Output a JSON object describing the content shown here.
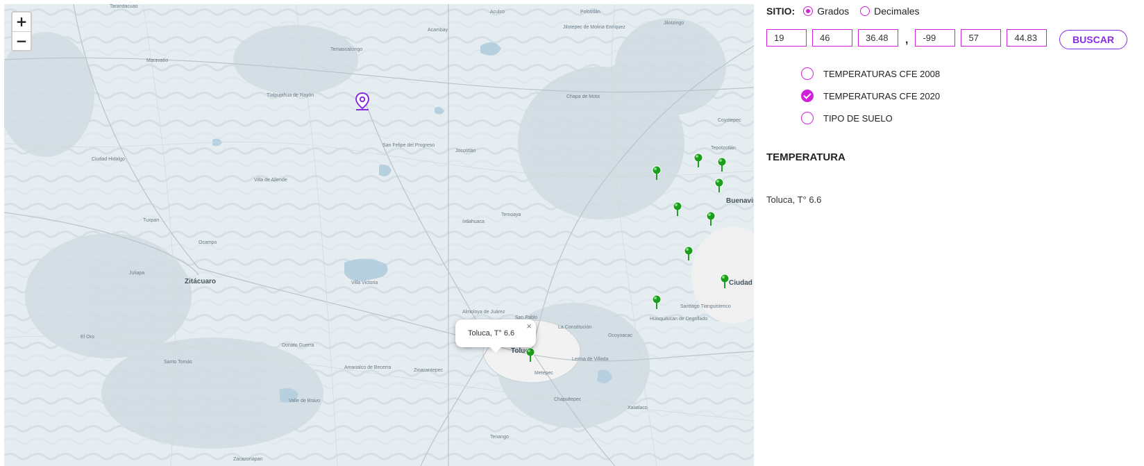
{
  "map": {
    "zoom_in": "+",
    "zoom_out": "−",
    "popup": {
      "text": "Toluca, T° 6.6",
      "close": "×"
    },
    "labels": [
      "Tarandacuao",
      "Maravatío",
      "Temascalcingo",
      "Tlalpujahua de Rayón",
      "Acambay",
      "Jilotepec de Molina Enríquez",
      "Chapa de Mota",
      "Ciudad Hidalgo",
      "Zitácuaro",
      "Villa Victoria",
      "Almoloya de Juárez",
      "Toluca",
      "Metepec",
      "Lerma de Villada",
      "Ocoyoacac",
      "Tenango",
      "Valle de Bravo",
      "Amanalco de Becerra",
      "Buenavista",
      "Ciudad",
      "Juliapa",
      "Tuxpan",
      "San Felipe del Progreso",
      "Ixtlahuaca",
      "Temoaya",
      "Jocotitlán",
      "Santiago Tianguistenco",
      "Huixquilucan de Degollado",
      "Chapultepec",
      "Xalatlaco",
      "Coyotepec",
      "Tepotzotlán",
      "Zinacantepec",
      "Villa de Allende",
      "Ocampo",
      "El Oro",
      "San Pablo",
      "La Constitución",
      "Aculco",
      "Polotitlán",
      "Jilotzingo",
      "Zacazonapan",
      "Santo Tomás",
      "Donato Guerra"
    ]
  },
  "panel": {
    "sitio_label": "SITIO:",
    "format_options": [
      {
        "label": "Grados",
        "selected": true
      },
      {
        "label": "Decimales",
        "selected": false
      }
    ],
    "coords": {
      "lat": [
        "19",
        "46",
        "36.48"
      ],
      "separator": ",",
      "lon": [
        "-99",
        "57",
        "44.83"
      ]
    },
    "buscar_label": "BUSCAR",
    "layers": [
      {
        "label": "TEMPERATURAS CFE 2008",
        "checked": false
      },
      {
        "label": "TEMPERATURAS CFE 2020",
        "checked": true
      },
      {
        "label": "TIPO DE SUELO",
        "checked": false
      }
    ],
    "section_title": "TEMPERATURA",
    "temperature_value": "Toluca, T° 6.6"
  },
  "colors": {
    "accent": "#d021d8",
    "button": "#8a2be2",
    "marker": "#1e9e1e",
    "water": "#b7d0e0",
    "location_pin": "#8a2be2"
  },
  "icons": {
    "zoom_in": "plus-icon",
    "zoom_out": "minus-icon",
    "station_marker": "map-marker-icon",
    "location": "location-pin-icon",
    "close": "close-icon"
  }
}
